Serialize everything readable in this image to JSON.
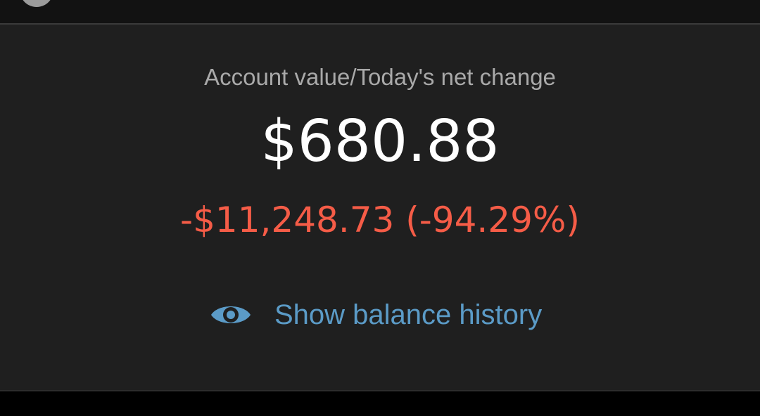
{
  "account": {
    "caption": "Account value/Today's net change",
    "value": "$680.88",
    "change": "-$11,248.73 (-94.29%)"
  },
  "actions": {
    "show_history_label": "Show balance history",
    "show_history_icon": "eye-icon"
  },
  "colors": {
    "background": "#1f1f1f",
    "caption": "#a9a9a9",
    "value": "#ffffff",
    "negative_change": "#f55c47",
    "link": "#5b9bc7"
  }
}
